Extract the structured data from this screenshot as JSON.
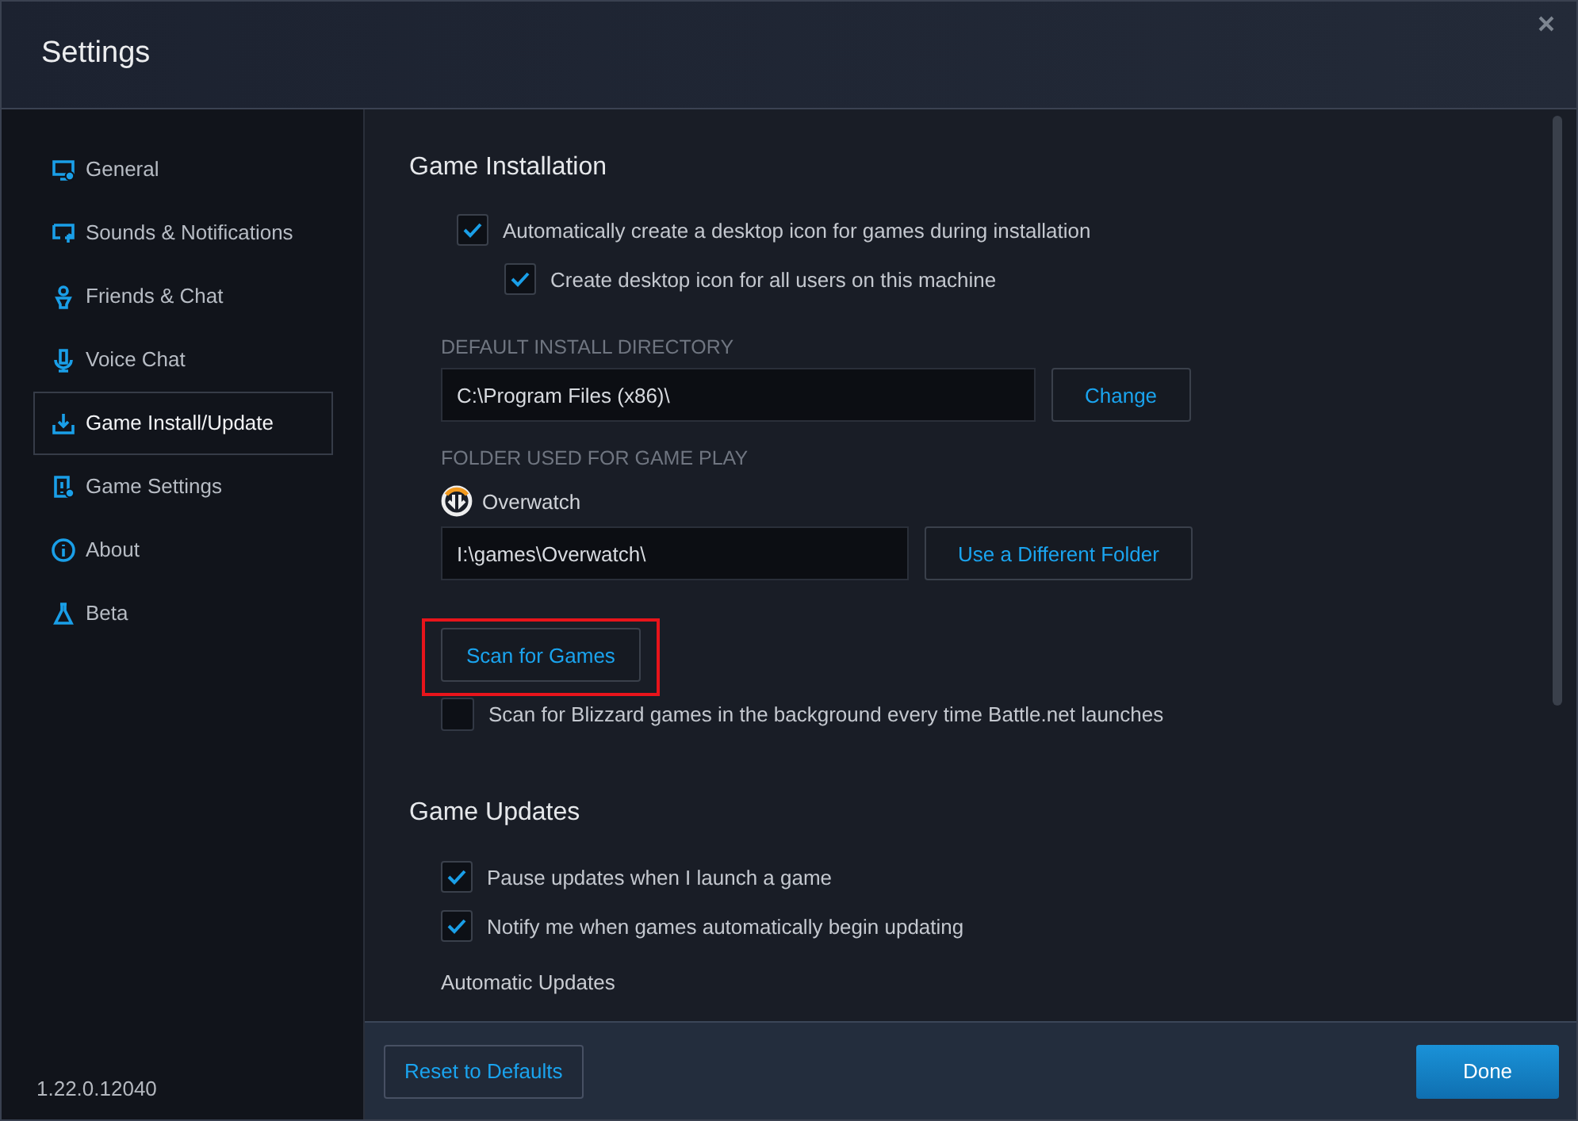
{
  "window": {
    "title": "Settings"
  },
  "sidebar": {
    "items": [
      {
        "label": "General",
        "selected": false
      },
      {
        "label": "Sounds & Notifications",
        "selected": false
      },
      {
        "label": "Friends & Chat",
        "selected": false
      },
      {
        "label": "Voice Chat",
        "selected": false
      },
      {
        "label": "Game Install/Update",
        "selected": true
      },
      {
        "label": "Game Settings",
        "selected": false
      },
      {
        "label": "About",
        "selected": false
      },
      {
        "label": "Beta",
        "selected": false
      }
    ],
    "version": "1.22.0.12040"
  },
  "game_installation": {
    "heading": "Game Installation",
    "options": [
      {
        "label": "Automatically create a desktop icon for games during installation",
        "checked": true,
        "children": [
          {
            "label": "Create desktop icon for all users on this machine",
            "checked": true
          }
        ]
      }
    ],
    "default_directory": {
      "label": "DEFAULT INSTALL DIRECTORY",
      "value": "C:\\Program Files (x86)\\",
      "button": "Change"
    },
    "game_folder": {
      "label": "FOLDER USED FOR GAME PLAY",
      "game": "Overwatch",
      "value": "I:\\games\\Overwatch\\",
      "button": "Use a Different Folder"
    },
    "scan_button": {
      "label": "Scan for Games",
      "highlighted": true
    },
    "background_scan": {
      "label": "Scan for Blizzard games in the background every time Battle.net launches",
      "checked": false
    }
  },
  "game_updates": {
    "heading": "Game Updates",
    "options": [
      {
        "label": "Pause updates when I launch a game",
        "checked": true
      },
      {
        "label": "Notify me when games automatically begin updating",
        "checked": true
      }
    ],
    "subheading": "Automatic Updates"
  },
  "footer": {
    "reset": "Reset to Defaults",
    "done": "Done"
  }
}
